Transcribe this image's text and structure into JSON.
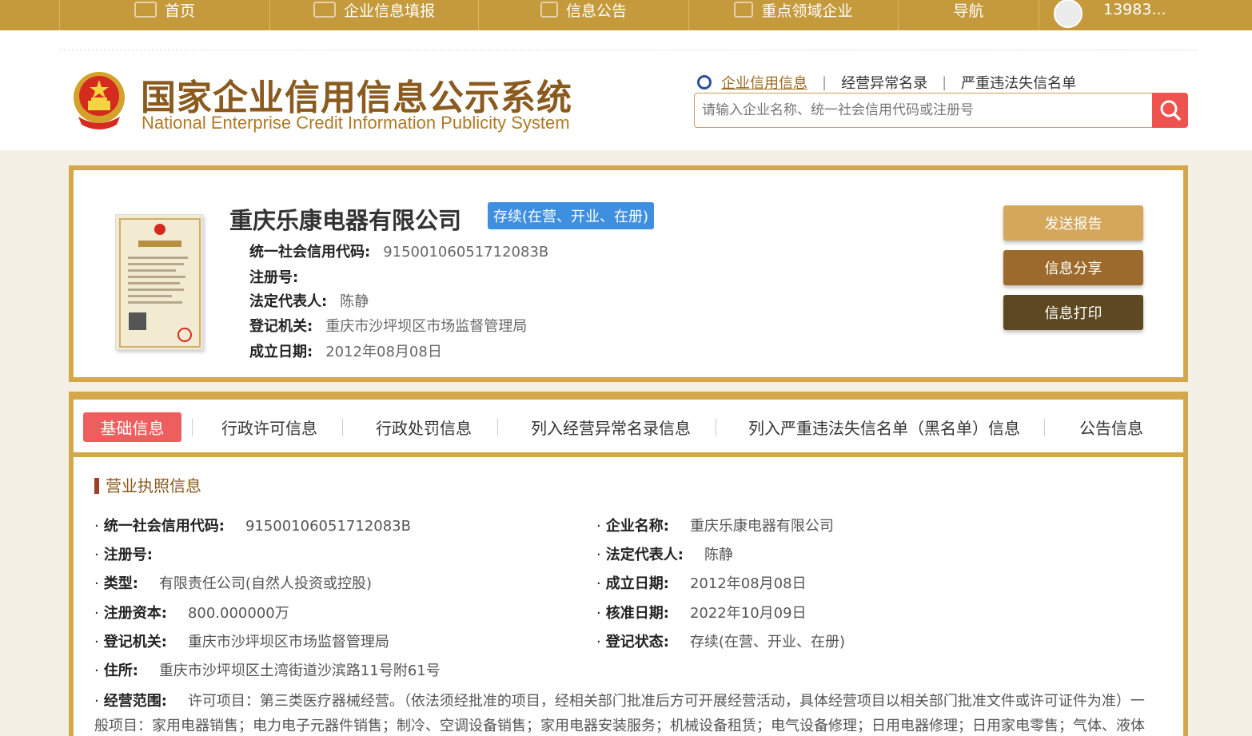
{
  "nav": {
    "items": [
      "首页",
      "企业信息填报",
      "信息公告",
      "重点领域企业",
      "导航"
    ],
    "user": "13983..."
  },
  "header": {
    "logo_cn": "国家企业信用信息公示系统",
    "logo_en": "National Enterprise Credit Information Publicity System",
    "search_tabs": [
      "企业信用信息",
      "经营异常名录",
      "严重违法失信名单"
    ],
    "search_placeholder": "请输入企业名称、统一社会信用代码或注册号"
  },
  "company": {
    "name": "重庆乐康电器有限公司",
    "status": "存续(在营、开业、在册)",
    "fields": [
      {
        "label": "统一社会信用代码:",
        "value": "91500106051712083B"
      },
      {
        "label": "注册号:",
        "value": ""
      },
      {
        "label": "法定代表人:",
        "value": "陈静"
      },
      {
        "label": "登记机关:",
        "value": "重庆市沙坪坝区市场监督管理局"
      },
      {
        "label": "成立日期:",
        "value": "2012年08月08日"
      }
    ],
    "actions": [
      "发送报告",
      "信息分享",
      "信息打印"
    ]
  },
  "tabs": [
    "基础信息",
    "行政许可信息",
    "行政处罚信息",
    "列入经营异常名录信息",
    "列入严重违法失信名单（黑名单）信息",
    "公告信息"
  ],
  "license": {
    "section_title": "营业执照信息",
    "left": [
      {
        "label": "统一社会信用代码:",
        "value": "91500106051712083B"
      },
      {
        "label": "注册号:",
        "value": ""
      },
      {
        "label": "类型:",
        "value": "有限责任公司(自然人投资或控股)"
      },
      {
        "label": "注册资本:",
        "value": "800.000000万"
      },
      {
        "label": "登记机关:",
        "value": "重庆市沙坪坝区市场监督管理局"
      },
      {
        "label": "住所:",
        "value": "重庆市沙坪坝区土湾街道沙滨路11号附61号"
      }
    ],
    "right": [
      {
        "label": "企业名称:",
        "value": "重庆乐康电器有限公司"
      },
      {
        "label": "法定代表人:",
        "value": "陈静"
      },
      {
        "label": "成立日期:",
        "value": "2012年08月08日"
      },
      {
        "label": "核准日期:",
        "value": "2022年10月09日"
      },
      {
        "label": "登记状态:",
        "value": "存续(在营、开业、在册)"
      }
    ],
    "scope_label": "经营范围:",
    "scope_value": "许可项目：第三类医疗器械经营。（依法须经批准的项目，经相关部门批准后方可开展经营活动，具体经营项目以相关部门批准文件或许可证件为准）一般项目：家用电器销售；电力电子元器件销售；制冷、空调设备销售；家用电器安装服务；机械设备租赁；电气设备修理；日用电器修理；日用家电零售；气体、液体分离及"
  },
  "colors": {
    "gold": "#c59a3c",
    "frame": "#d4a84a",
    "badge": "#3e8fe0",
    "active_tab": "#ef5e5e",
    "search_btn": "#ef5350"
  }
}
